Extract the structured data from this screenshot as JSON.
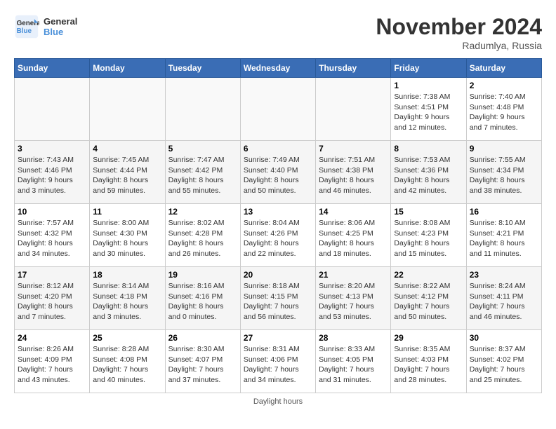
{
  "logo": {
    "line1": "General",
    "line2": "Blue"
  },
  "title": "November 2024",
  "subtitle": "Radumlya, Russia",
  "days_header": [
    "Sunday",
    "Monday",
    "Tuesday",
    "Wednesday",
    "Thursday",
    "Friday",
    "Saturday"
  ],
  "weeks": [
    [
      {
        "num": "",
        "info": ""
      },
      {
        "num": "",
        "info": ""
      },
      {
        "num": "",
        "info": ""
      },
      {
        "num": "",
        "info": ""
      },
      {
        "num": "",
        "info": ""
      },
      {
        "num": "1",
        "info": "Sunrise: 7:38 AM\nSunset: 4:51 PM\nDaylight: 9 hours and 12 minutes."
      },
      {
        "num": "2",
        "info": "Sunrise: 7:40 AM\nSunset: 4:48 PM\nDaylight: 9 hours and 7 minutes."
      }
    ],
    [
      {
        "num": "3",
        "info": "Sunrise: 7:43 AM\nSunset: 4:46 PM\nDaylight: 9 hours and 3 minutes."
      },
      {
        "num": "4",
        "info": "Sunrise: 7:45 AM\nSunset: 4:44 PM\nDaylight: 8 hours and 59 minutes."
      },
      {
        "num": "5",
        "info": "Sunrise: 7:47 AM\nSunset: 4:42 PM\nDaylight: 8 hours and 55 minutes."
      },
      {
        "num": "6",
        "info": "Sunrise: 7:49 AM\nSunset: 4:40 PM\nDaylight: 8 hours and 50 minutes."
      },
      {
        "num": "7",
        "info": "Sunrise: 7:51 AM\nSunset: 4:38 PM\nDaylight: 8 hours and 46 minutes."
      },
      {
        "num": "8",
        "info": "Sunrise: 7:53 AM\nSunset: 4:36 PM\nDaylight: 8 hours and 42 minutes."
      },
      {
        "num": "9",
        "info": "Sunrise: 7:55 AM\nSunset: 4:34 PM\nDaylight: 8 hours and 38 minutes."
      }
    ],
    [
      {
        "num": "10",
        "info": "Sunrise: 7:57 AM\nSunset: 4:32 PM\nDaylight: 8 hours and 34 minutes."
      },
      {
        "num": "11",
        "info": "Sunrise: 8:00 AM\nSunset: 4:30 PM\nDaylight: 8 hours and 30 minutes."
      },
      {
        "num": "12",
        "info": "Sunrise: 8:02 AM\nSunset: 4:28 PM\nDaylight: 8 hours and 26 minutes."
      },
      {
        "num": "13",
        "info": "Sunrise: 8:04 AM\nSunset: 4:26 PM\nDaylight: 8 hours and 22 minutes."
      },
      {
        "num": "14",
        "info": "Sunrise: 8:06 AM\nSunset: 4:25 PM\nDaylight: 8 hours and 18 minutes."
      },
      {
        "num": "15",
        "info": "Sunrise: 8:08 AM\nSunset: 4:23 PM\nDaylight: 8 hours and 15 minutes."
      },
      {
        "num": "16",
        "info": "Sunrise: 8:10 AM\nSunset: 4:21 PM\nDaylight: 8 hours and 11 minutes."
      }
    ],
    [
      {
        "num": "17",
        "info": "Sunrise: 8:12 AM\nSunset: 4:20 PM\nDaylight: 8 hours and 7 minutes."
      },
      {
        "num": "18",
        "info": "Sunrise: 8:14 AM\nSunset: 4:18 PM\nDaylight: 8 hours and 3 minutes."
      },
      {
        "num": "19",
        "info": "Sunrise: 8:16 AM\nSunset: 4:16 PM\nDaylight: 8 hours and 0 minutes."
      },
      {
        "num": "20",
        "info": "Sunrise: 8:18 AM\nSunset: 4:15 PM\nDaylight: 7 hours and 56 minutes."
      },
      {
        "num": "21",
        "info": "Sunrise: 8:20 AM\nSunset: 4:13 PM\nDaylight: 7 hours and 53 minutes."
      },
      {
        "num": "22",
        "info": "Sunrise: 8:22 AM\nSunset: 4:12 PM\nDaylight: 7 hours and 50 minutes."
      },
      {
        "num": "23",
        "info": "Sunrise: 8:24 AM\nSunset: 4:11 PM\nDaylight: 7 hours and 46 minutes."
      }
    ],
    [
      {
        "num": "24",
        "info": "Sunrise: 8:26 AM\nSunset: 4:09 PM\nDaylight: 7 hours and 43 minutes."
      },
      {
        "num": "25",
        "info": "Sunrise: 8:28 AM\nSunset: 4:08 PM\nDaylight: 7 hours and 40 minutes."
      },
      {
        "num": "26",
        "info": "Sunrise: 8:30 AM\nSunset: 4:07 PM\nDaylight: 7 hours and 37 minutes."
      },
      {
        "num": "27",
        "info": "Sunrise: 8:31 AM\nSunset: 4:06 PM\nDaylight: 7 hours and 34 minutes."
      },
      {
        "num": "28",
        "info": "Sunrise: 8:33 AM\nSunset: 4:05 PM\nDaylight: 7 hours and 31 minutes."
      },
      {
        "num": "29",
        "info": "Sunrise: 8:35 AM\nSunset: 4:03 PM\nDaylight: 7 hours and 28 minutes."
      },
      {
        "num": "30",
        "info": "Sunrise: 8:37 AM\nSunset: 4:02 PM\nDaylight: 7 hours and 25 minutes."
      }
    ]
  ],
  "footer": "Daylight hours"
}
